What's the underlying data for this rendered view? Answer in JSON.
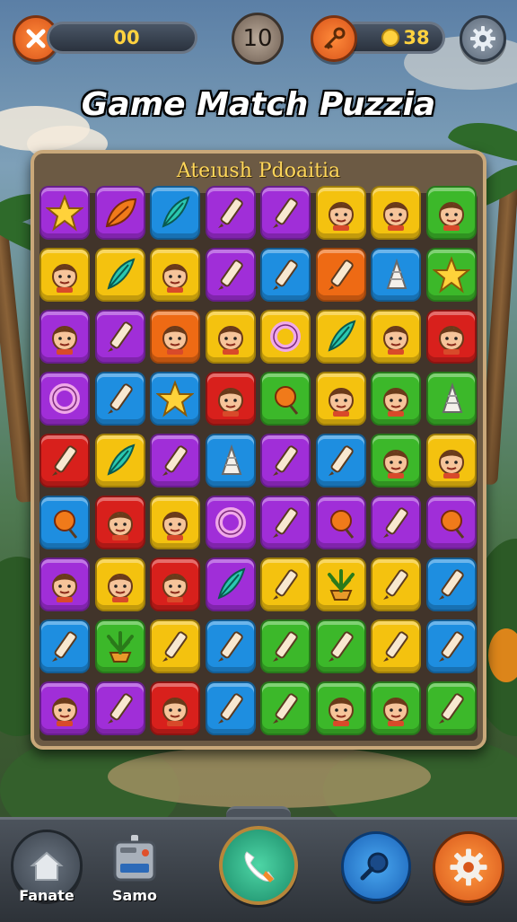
{
  "header": {
    "score": "00",
    "moves": "10",
    "coins": "38",
    "close_icon": "close-icon",
    "key_icon": "key-icon",
    "settings_icon": "gear-icon"
  },
  "title": "Game Match Puzzia",
  "board": {
    "title": "Ateıush Pdoaitia",
    "rows": [
      [
        [
          "purple",
          "star"
        ],
        [
          "purple",
          "leaf"
        ],
        [
          "blue",
          "feather"
        ],
        [
          "purple",
          "crayon"
        ],
        [
          "purple",
          "crayon"
        ],
        [
          "yellow",
          "face"
        ],
        [
          "yellow",
          "face"
        ],
        [
          "green",
          "face"
        ]
      ],
      [
        [
          "yellow",
          "face"
        ],
        [
          "yellow",
          "feather"
        ],
        [
          "yellow",
          "face"
        ],
        [
          "purple",
          "crayon"
        ],
        [
          "blue",
          "crayon"
        ],
        [
          "orange",
          "crayon"
        ],
        [
          "blue",
          "cone"
        ],
        [
          "green",
          "star"
        ]
      ],
      [
        [
          "purple",
          "face"
        ],
        [
          "purple",
          "crayon"
        ],
        [
          "orange",
          "face"
        ],
        [
          "yellow",
          "face"
        ],
        [
          "yellow",
          "ring"
        ],
        [
          "yellow",
          "feather"
        ],
        [
          "yellow",
          "face"
        ],
        [
          "red",
          "face"
        ]
      ],
      [
        [
          "purple",
          "ring"
        ],
        [
          "blue",
          "crayon"
        ],
        [
          "blue",
          "star"
        ],
        [
          "red",
          "face"
        ],
        [
          "green",
          "ball"
        ],
        [
          "yellow",
          "face"
        ],
        [
          "green",
          "face"
        ],
        [
          "green",
          "cone"
        ]
      ],
      [
        [
          "red",
          "crayon"
        ],
        [
          "yellow",
          "feather"
        ],
        [
          "purple",
          "crayon"
        ],
        [
          "blue",
          "cone"
        ],
        [
          "purple",
          "crayon"
        ],
        [
          "blue",
          "crayon"
        ],
        [
          "green",
          "face"
        ],
        [
          "yellow",
          "face"
        ]
      ],
      [
        [
          "blue",
          "ball"
        ],
        [
          "red",
          "face"
        ],
        [
          "yellow",
          "face"
        ],
        [
          "purple",
          "ring"
        ],
        [
          "purple",
          "crayon"
        ],
        [
          "purple",
          "ball"
        ],
        [
          "purple",
          "crayon"
        ],
        [
          "purple",
          "ball"
        ]
      ],
      [
        [
          "purple",
          "face"
        ],
        [
          "yellow",
          "face"
        ],
        [
          "red",
          "face"
        ],
        [
          "purple",
          "feather"
        ],
        [
          "yellow",
          "crayon"
        ],
        [
          "yellow",
          "plant"
        ],
        [
          "yellow",
          "crayon"
        ],
        [
          "blue",
          "crayon"
        ]
      ],
      [
        [
          "blue",
          "crayon"
        ],
        [
          "green",
          "plant"
        ],
        [
          "yellow",
          "crayon"
        ],
        [
          "blue",
          "crayon"
        ],
        [
          "green",
          "crayon"
        ],
        [
          "green",
          "crayon"
        ],
        [
          "yellow",
          "crayon"
        ],
        [
          "blue",
          "crayon"
        ]
      ],
      [
        [
          "purple",
          "face"
        ],
        [
          "purple",
          "crayon"
        ],
        [
          "red",
          "face"
        ],
        [
          "blue",
          "crayon"
        ],
        [
          "green",
          "crayon"
        ],
        [
          "green",
          "face"
        ],
        [
          "green",
          "face"
        ],
        [
          "green",
          "crayon"
        ]
      ]
    ]
  },
  "bottom_nav": {
    "home_label": "Fanate",
    "radio_label": "Samo",
    "home_icon": "home-icon",
    "radio_icon": "radio-icon",
    "phone_icon": "phone-icon",
    "search_icon": "magnifier-icon",
    "settings_icon": "gear-icon"
  },
  "colors": {
    "purple": "#a02ed8",
    "blue": "#1e8ee0",
    "yellow": "#f4c20f",
    "green": "#3cb82a",
    "red": "#d8201c",
    "orange": "#ee6a14"
  }
}
